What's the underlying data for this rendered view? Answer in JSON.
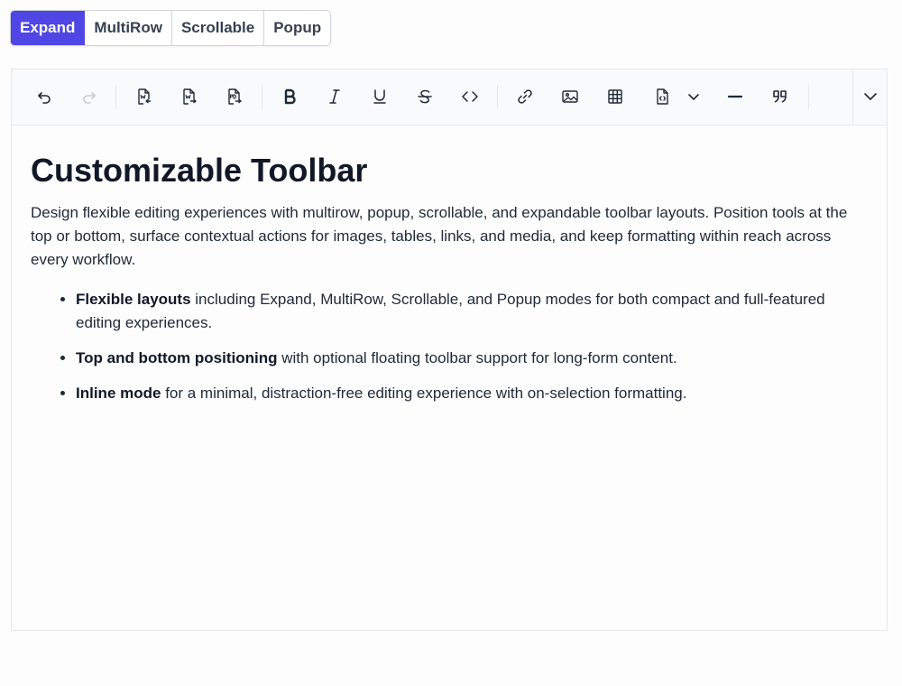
{
  "modes": {
    "items": [
      {
        "label": "Expand",
        "active": true
      },
      {
        "label": "MultiRow",
        "active": false
      },
      {
        "label": "Scrollable",
        "active": false
      },
      {
        "label": "Popup",
        "active": false
      }
    ]
  },
  "toolbar": {
    "icons": [
      "undo-icon",
      "redo-icon",
      "import-word-icon",
      "export-word-icon",
      "export-pdf-icon",
      "bold-icon",
      "italic-icon",
      "underline-icon",
      "strikethrough-icon",
      "inline-code-icon",
      "link-icon",
      "image-icon",
      "table-icon",
      "code-block-icon",
      "chevron-down-icon",
      "horizontal-line-icon",
      "blockquote-icon",
      "expand-toolbar-icon"
    ],
    "expand_icon": "chevron-down-icon",
    "colors": {
      "icon": "#1f2937",
      "disabled": "#c7cbd1",
      "accent": "#4f46e5"
    }
  },
  "content": {
    "title": "Customizable Toolbar",
    "intro": "Design flexible editing experiences with multirow, popup, scrollable, and expandable toolbar layouts. Position tools at the top or bottom, surface contextual actions for images, tables, links, and media, and keep formatting within reach across every workflow.",
    "bullets": [
      {
        "bold": "Flexible layouts",
        "text": " including Expand, MultiRow, Scrollable, and Popup modes for both compact and full-featured editing experiences."
      },
      {
        "bold": "Top and bottom positioning",
        "text": " with optional floating toolbar support for long-form content."
      },
      {
        "bold": "Inline mode",
        "text": " for a minimal, distraction-free editing experience with on-selection formatting."
      }
    ]
  }
}
